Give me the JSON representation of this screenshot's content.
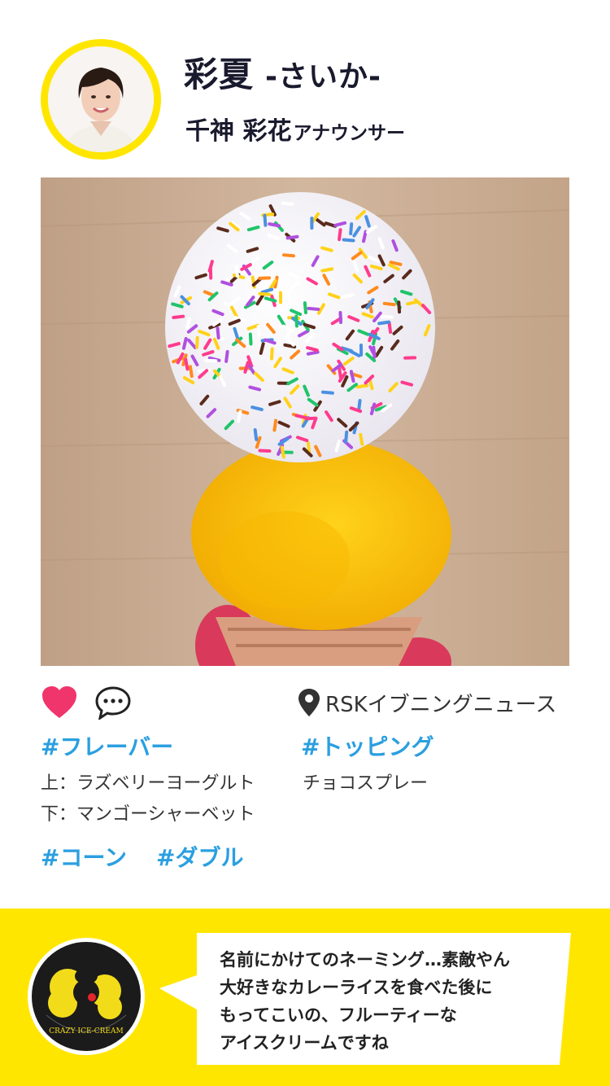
{
  "header": {
    "title": "彩夏",
    "title_suffix": "-さいか-",
    "announcer_name": "千神 彩花",
    "announcer_role": "アナウンサー"
  },
  "actions": {
    "like_icon": "heart-icon",
    "comment_icon": "comment-icon",
    "location_icon": "pin-icon",
    "location": "RSKイブニングニュース"
  },
  "tags": {
    "flavor": "#フレーバー",
    "topping": "#トッピング",
    "cone": "#コーン",
    "double": "#ダブル"
  },
  "details": {
    "flavor_top": "上：ラズベリーヨーグルト",
    "flavor_bottom": "下：マンゴーシャーベット",
    "topping": "チョコスプレー"
  },
  "comment": {
    "lines": [
      "名前にかけてのネーミング…素敵やん",
      "大好きなカレーライスを食べた後に",
      "もってこいの、フルーティーな",
      "アイスクリームですね"
    ]
  },
  "logo": {
    "text": "CRAZY ICE-CREAM"
  },
  "colors": {
    "accent_yellow": "#ffe600",
    "tag_blue": "#2b9fe0",
    "heart_pink": "#f0346c",
    "title_navy": "#1a1a2e"
  }
}
